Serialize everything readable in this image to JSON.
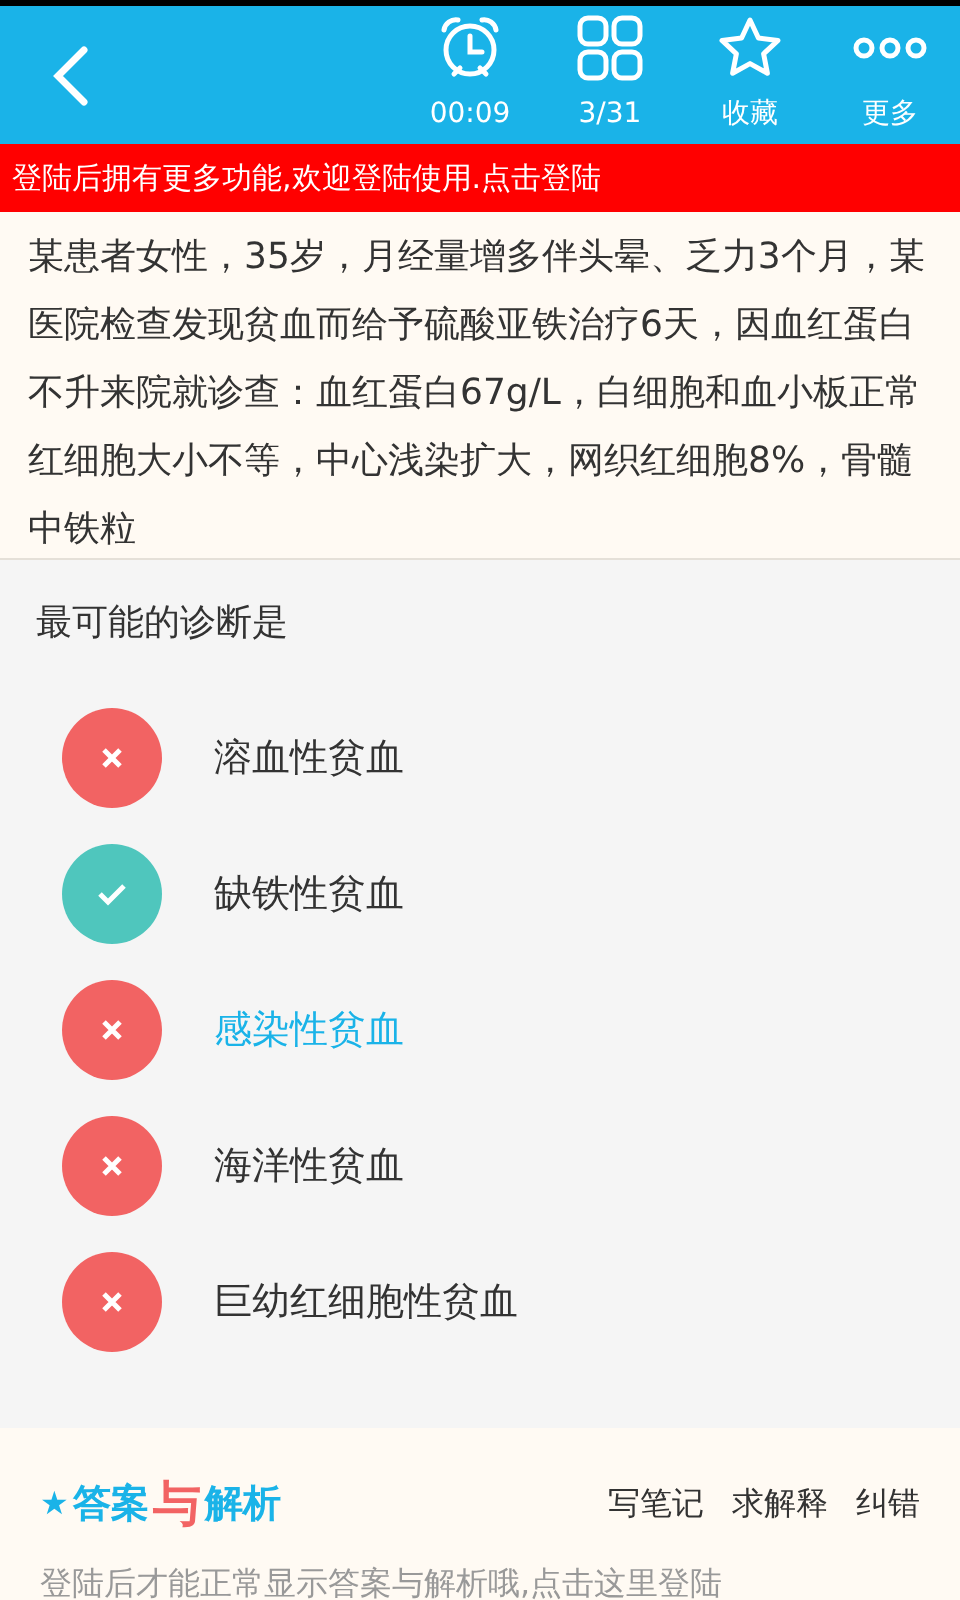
{
  "toolbar": {
    "items": [
      {
        "kind": "alarm",
        "label": "00:09"
      },
      {
        "kind": "grid",
        "label": "3/31"
      },
      {
        "kind": "star",
        "label": "收藏"
      },
      {
        "kind": "more",
        "label": "更多"
      }
    ]
  },
  "login_banner": "登陆后拥有更多功能,欢迎登陆使用.点击登陆",
  "question": "某患者女性，35岁，月经量增多伴头晕、乏力3个月，某医院检查发现贫血而给予硫酸亚铁治疗6天，因血红蛋白不升来院就诊查：血红蛋白67g/L，白细胞和血小板正常红细胞大小不等，中心浅染扩大，网织红细胞8%，骨髓中铁粒",
  "prompt": "最可能的诊断是",
  "options": [
    {
      "label": "溶血性贫血",
      "kind": "wrong",
      "selected": false
    },
    {
      "label": "缺铁性贫血",
      "kind": "correct",
      "selected": false
    },
    {
      "label": "感染性贫血",
      "kind": "wrong",
      "selected": true
    },
    {
      "label": "海洋性贫血",
      "kind": "wrong",
      "selected": false
    },
    {
      "label": "巨幼红细胞性贫血",
      "kind": "wrong",
      "selected": false
    }
  ],
  "answer_section": {
    "logo": [
      "★",
      "答案",
      "与",
      "解析"
    ],
    "actions": [
      "写笔记",
      "求解释",
      "纠错"
    ],
    "notice": "登陆后才能正常显示答案与解析哦,点击这里登陆"
  }
}
